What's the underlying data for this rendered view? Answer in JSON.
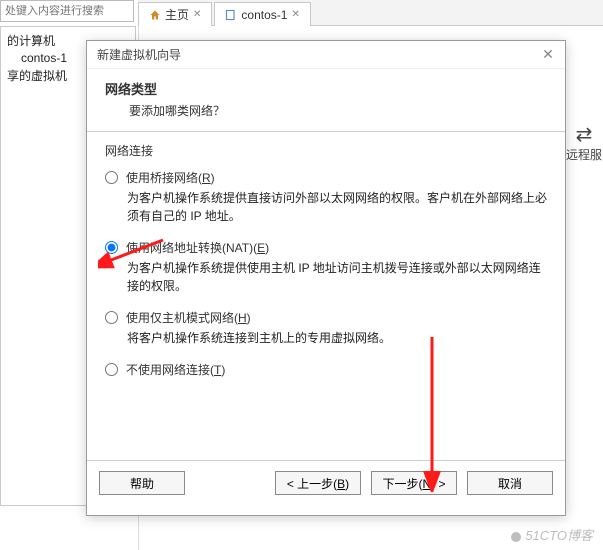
{
  "search": {
    "placeholder": "处键入内容进行搜索"
  },
  "tree": {
    "root": "的计算机",
    "child": "contos-1",
    "shared": "享的虚拟机"
  },
  "tabs": {
    "home": {
      "label": "主页"
    },
    "doc": {
      "label": "contos-1"
    }
  },
  "right_panel": {
    "label": "远程服"
  },
  "dialog": {
    "title": "新建虚拟机向导",
    "header": {
      "title": "网络类型",
      "subtitle": "要添加哪类网络？"
    },
    "group_label": "网络连接",
    "options": {
      "bridged": {
        "label_pre": "使用桥接网络(",
        "accel": "R",
        "label_post": ")",
        "desc": "为客户机操作系统提供直接访问外部以太网网络的权限。客户机在外部网络上必须有自己的 IP 地址。"
      },
      "nat": {
        "label_pre": "使用网络地址转换(NAT)(",
        "accel": "E",
        "label_post": ")",
        "desc": "为客户机操作系统提供使用主机 IP 地址访问主机拨号连接或外部以太网网络连接的权限。"
      },
      "hostonly": {
        "label_pre": "使用仅主机模式网络(",
        "accel": "H",
        "label_post": ")",
        "desc": "将客户机操作系统连接到主机上的专用虚拟网络。"
      },
      "none": {
        "label_pre": "不使用网络连接(",
        "accel": "T",
        "label_post": ")"
      }
    },
    "buttons": {
      "help": "帮助",
      "back_pre": "< 上一步(",
      "back_accel": "B",
      "back_post": ")",
      "next_pre": "下一步(",
      "next_accel": "N",
      "next_post": ") >",
      "cancel": "取消"
    }
  },
  "watermark": "51CTO博客"
}
